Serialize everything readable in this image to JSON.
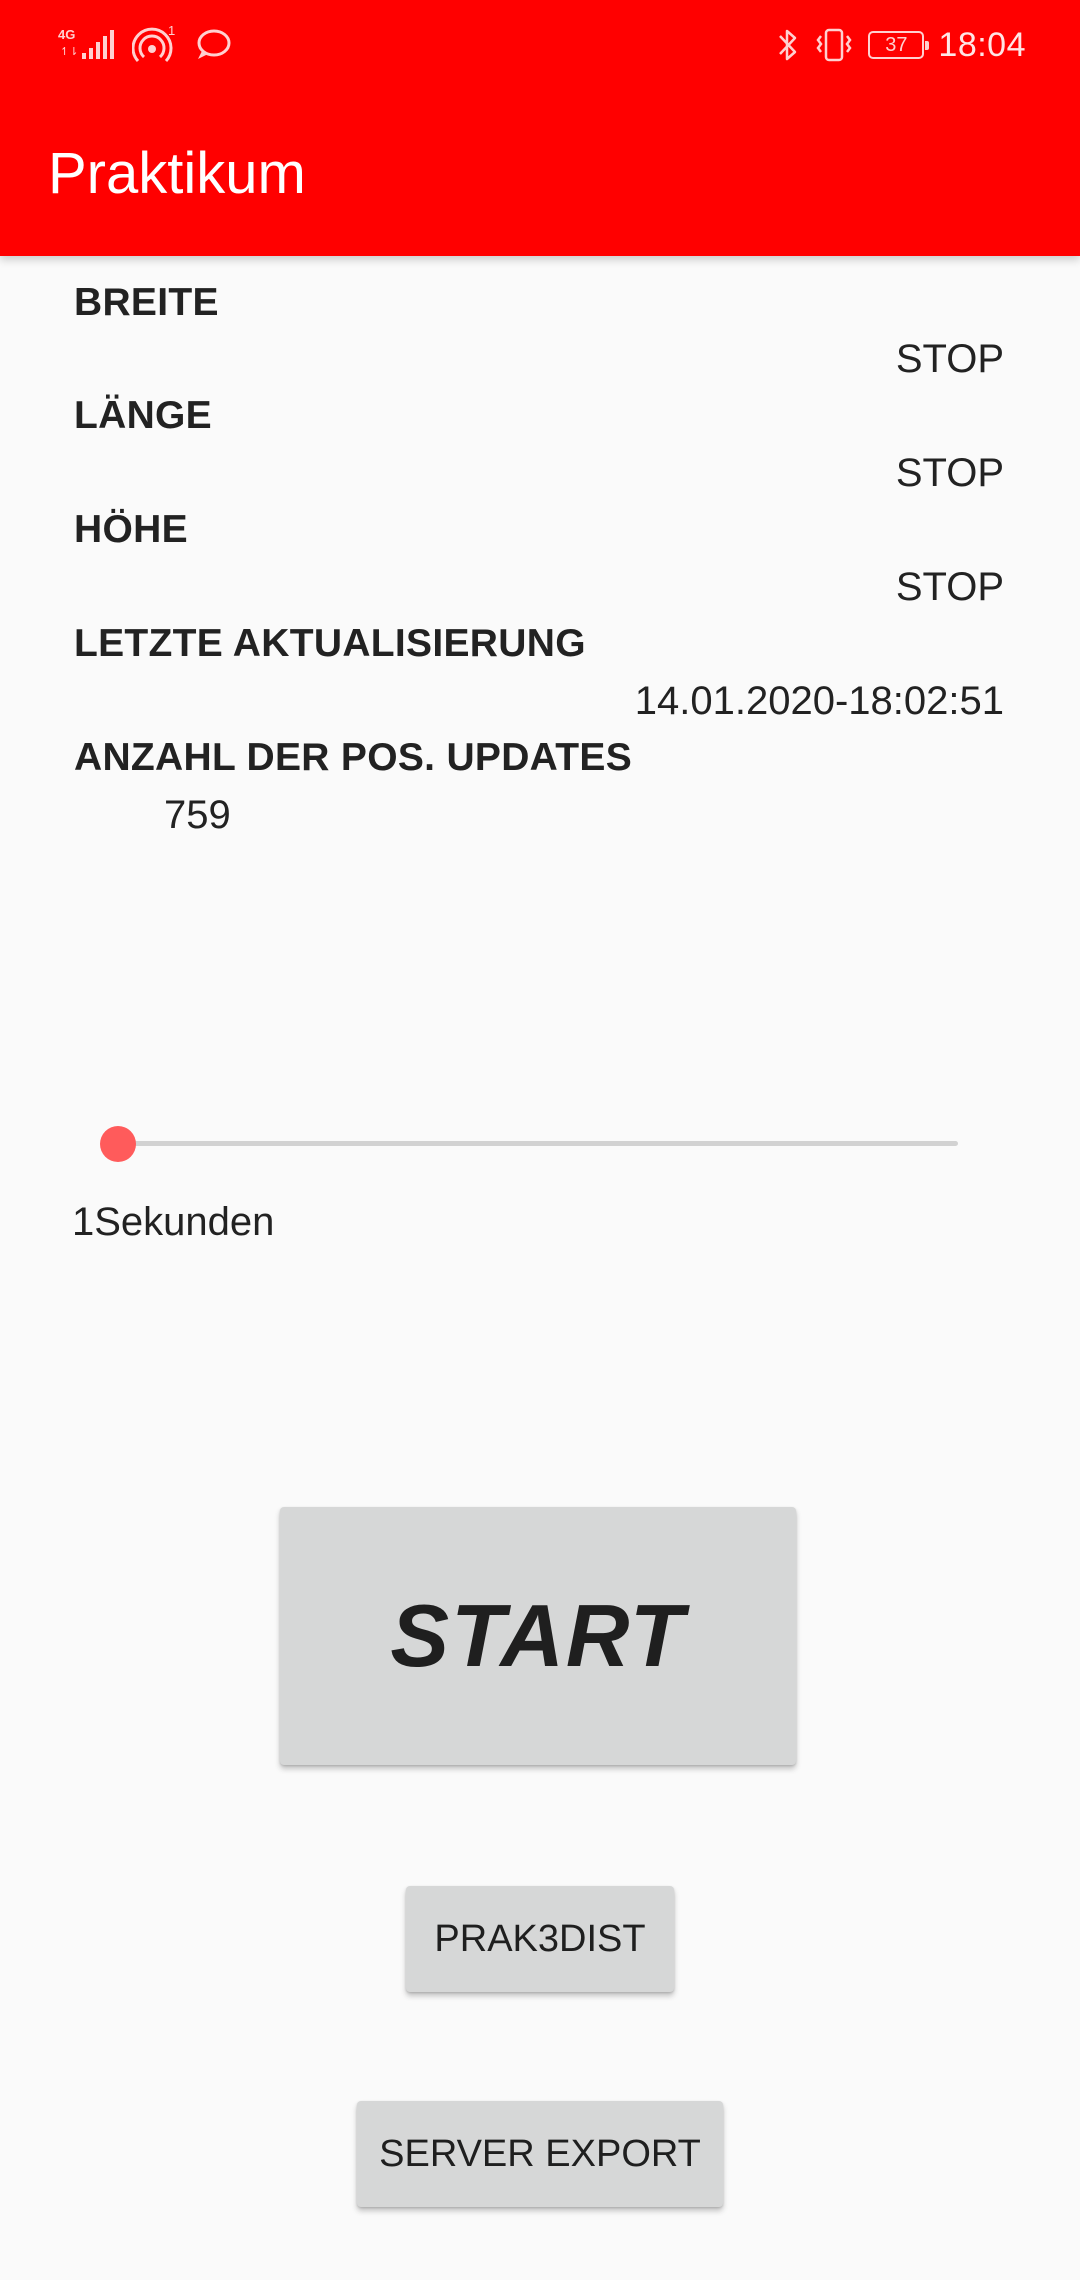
{
  "status_bar": {
    "network": "4G",
    "hotspot_count": "1",
    "battery_level": "37",
    "time": "18:04"
  },
  "header": {
    "title": "Praktikum",
    "color": "#ff0000"
  },
  "fields": {
    "breite_label": "BREITE",
    "breite_value": "STOP",
    "laenge_label": "LÄNGE",
    "laenge_value": "STOP",
    "hoehe_label": "HÖHE",
    "hoehe_value": "STOP",
    "update_label": "LETZTE AKTUALISIERUNG",
    "update_value": "14.01.2020-18:02:51",
    "count_label": "ANZAHL DER POS. UPDATES",
    "count_value": "759"
  },
  "slider": {
    "value_fraction": 0.0,
    "caption": "1Sekunden",
    "accent_color": "#ff5b5b"
  },
  "buttons": {
    "start": "START",
    "prak3dist": "PRAK3DIST",
    "server_export": "SERVER EXPORT"
  }
}
